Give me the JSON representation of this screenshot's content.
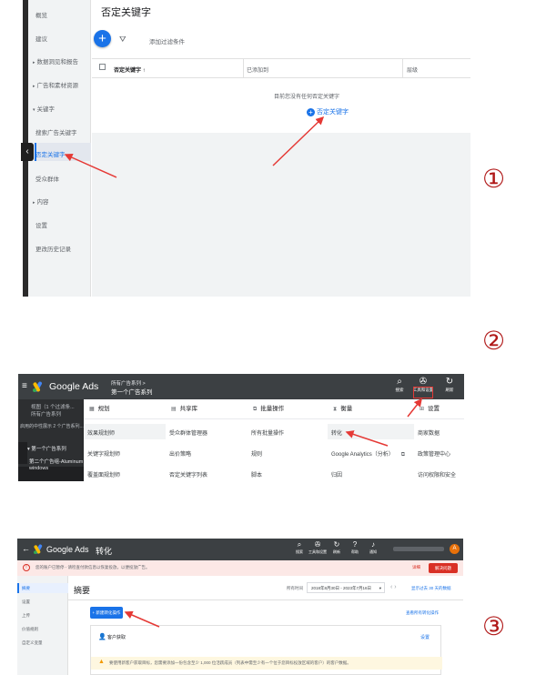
{
  "step_numbers": [
    "①",
    "②",
    "③"
  ],
  "colors": {
    "accent": "#1a73e8",
    "annotation": "#e53935",
    "topbar": "#3c4043",
    "step_number": "#b01818"
  },
  "panel1": {
    "sidebar": {
      "items": [
        {
          "label": "概览",
          "caret": false
        },
        {
          "label": "建议",
          "caret": false
        },
        {
          "label": "数据洞见和报告",
          "caret": true
        },
        {
          "label": "广告和素材资源",
          "caret": true
        },
        {
          "label": "关键字",
          "caret": true
        },
        {
          "label": "搜索广告关键字",
          "caret": false
        },
        {
          "label": "否定关键字",
          "caret": false
        },
        {
          "label": "受众群体",
          "caret": false
        },
        {
          "label": "内容",
          "caret": true
        },
        {
          "label": "设置",
          "caret": false
        },
        {
          "label": "更改历史记录",
          "caret": false
        }
      ],
      "active_index": 6,
      "collapse_icon": "chevron-left-icon"
    },
    "title": "否定关键字",
    "add_button_icon": "plus-icon",
    "filter_icon": "filter-icon",
    "add_filter_label": "添加过滤条件",
    "table_headers": [
      "否定关键字 ↑",
      "已添加到",
      "层级"
    ],
    "empty_message": "目前您没有任何否定关键字",
    "empty_action": "否定关键字"
  },
  "panel2": {
    "brand": "Google Ads",
    "breadcrumb_parent": "所有广告系列 >",
    "breadcrumb_current": "第一个广告系列",
    "tools": [
      {
        "icon": "search-icon",
        "glyph": "⌕",
        "label": "搜索"
      },
      {
        "icon": "wrench-icon",
        "glyph": "✇",
        "label": "工具和设置"
      },
      {
        "icon": "refresh-icon",
        "glyph": "↻",
        "label": "刷新"
      }
    ],
    "sidebar": {
      "line1": "视图（1 个过滤条...",
      "line2": "所有广告系列",
      "line3": "启用的中性展示 2 个广告系列...",
      "item1": "第一个广告系列",
      "item2": "第二个广告组-Aluminum windows"
    },
    "menu": {
      "columns": [
        {
          "icon": "calendar-icon",
          "glyph": "▦",
          "title": "规划",
          "items": [
            "效果规划师",
            "关键字规划师",
            "覆盖面规划师"
          ]
        },
        {
          "icon": "library-icon",
          "glyph": "▤",
          "title": "共享库",
          "items": [
            "受众群体管理器",
            "出价策略",
            "否定关键字列表"
          ]
        },
        {
          "icon": "copy-icon",
          "glyph": "⧉",
          "title": "批量操作",
          "items": [
            "所有批量操作",
            "规则",
            "脚本"
          ]
        },
        {
          "icon": "hourglass-icon",
          "glyph": "⧗",
          "title": "衡量",
          "items": [
            "转化",
            "Google Analytics（分析）",
            "归因"
          ]
        },
        {
          "icon": "grid-icon",
          "glyph": "⊞",
          "title": "设置",
          "items": [
            "商家数据",
            "政策管理中心",
            "访问权限和安全"
          ]
        }
      ]
    }
  },
  "panel3": {
    "brand": "Google Ads",
    "page_title": "转化",
    "tools": [
      {
        "icon": "search-icon",
        "glyph": "⌕",
        "label": "搜索"
      },
      {
        "icon": "wrench-icon",
        "glyph": "✇",
        "label": "工具和设置"
      },
      {
        "icon": "refresh-icon",
        "glyph": "↻",
        "label": "刷新"
      },
      {
        "icon": "help-icon",
        "glyph": "?",
        "label": "帮助"
      },
      {
        "icon": "bell-icon",
        "glyph": "♪",
        "label": "通知"
      }
    ],
    "avatar_letter": "A",
    "alert_text": "您的账户已暂停 - 请检查付款信息以恢复投放，以便投放广告。",
    "alert_link": "详细",
    "alert_button": "解决问题",
    "sidebar_items": [
      "摘要",
      "设置",
      "上传",
      "价值规则",
      "自定义变量"
    ],
    "heading": "摘要",
    "daterange_label": "所有时间",
    "daterange": "2018年8月30日 - 2023年7月16日",
    "nav_label": "显示过去 30 天的数据",
    "new_action_button": "+ 新建转化操作",
    "right_link": "查看所有转化操作",
    "card_title": "客户获取",
    "card_settings": "设置",
    "warning_text": "要使用新客户获取目标，您需要添加一份包含至少 1,000 位活跃成员（列表中需至少有一个位于您目标投放区域的客户）的客户数据。"
  }
}
